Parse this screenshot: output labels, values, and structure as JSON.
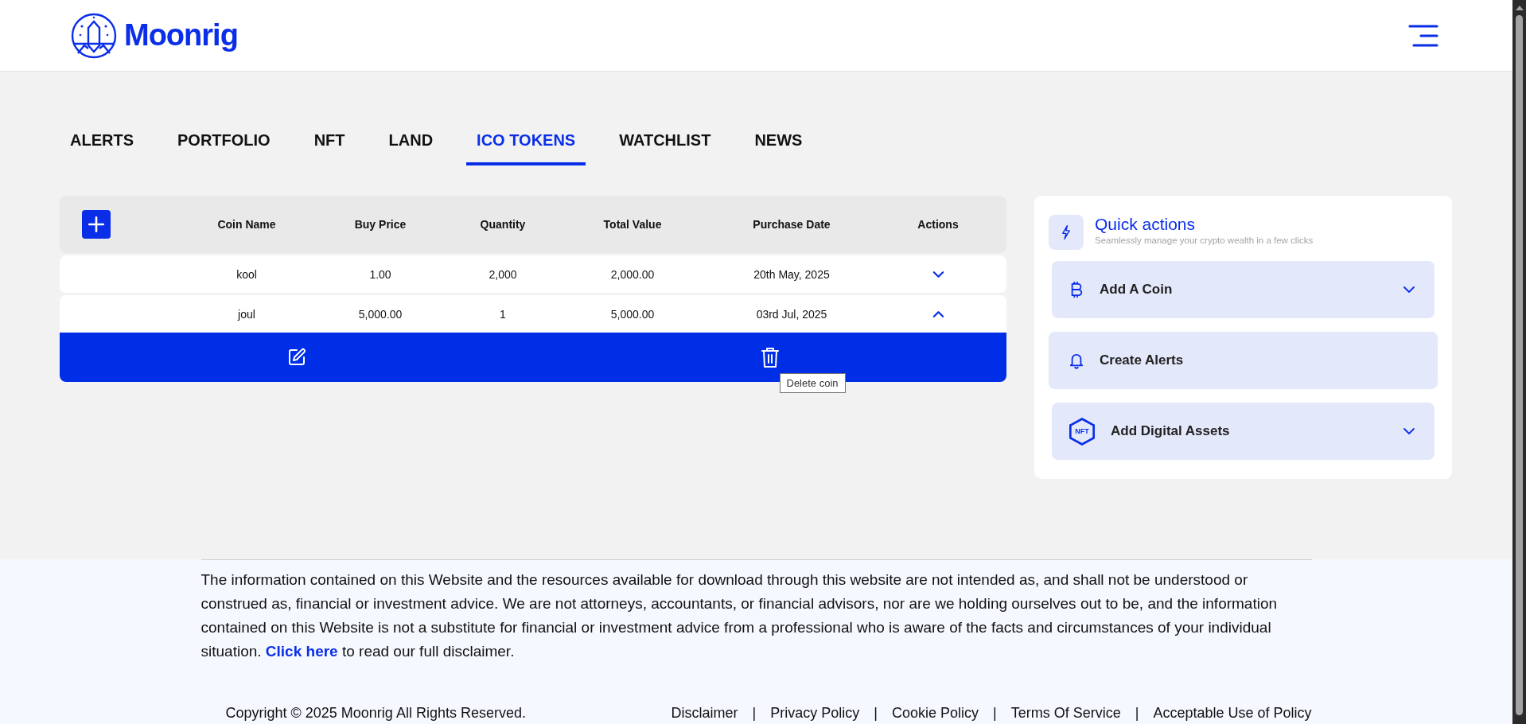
{
  "brand": {
    "name": "Moonrig"
  },
  "tabs": [
    {
      "label": "ALERTS",
      "selected": false
    },
    {
      "label": "PORTFOLIO",
      "selected": false
    },
    {
      "label": "NFT",
      "selected": false
    },
    {
      "label": "LAND",
      "selected": false
    },
    {
      "label": "ICO TOKENS",
      "selected": true
    },
    {
      "label": "WATCHLIST",
      "selected": false
    },
    {
      "label": "NEWS",
      "selected": false
    }
  ],
  "table": {
    "columns": [
      "Coin Name",
      "Buy Price",
      "Quantity",
      "Total Value",
      "Purchase Date",
      "Actions"
    ],
    "rows": [
      {
        "cells": [
          "kool",
          "1.00",
          "2,000",
          "2,000.00",
          "20th May, 2025"
        ],
        "expanded": false
      },
      {
        "cells": [
          "joul",
          "5,000.00",
          "1",
          "5,000.00",
          "03rd Jul, 2025"
        ],
        "expanded": true
      }
    ],
    "tooltip": "Delete coin"
  },
  "quick_actions": {
    "title": "Quick actions",
    "subtitle": "Seamlessly manage your crypto wealth in a few clicks",
    "items": [
      {
        "label": "Add A Coin",
        "kind": "coin"
      },
      {
        "label": "Create Alerts",
        "kind": "alert"
      },
      {
        "label": "Add Digital Assets",
        "kind": "asset",
        "icon_text": "NFT"
      }
    ]
  },
  "footer": {
    "disclaimer": "The information contained on this Website and the resources available for download through this website are not intended as, and shall not be understood or construed as, financial or investment advice. We are not attorneys, accountants, or financial advisors, nor are we holding ourselves out to be, and the information contained on this Website is not a substitute for financial or investment advice from a professional who is aware of the facts and circumstances of your individual situation.",
    "link": "Click here",
    "after_link": "to read our full disclaimer.",
    "copyright": "Copyright © 2025 Moonrig All Rights Reserved.",
    "links": [
      "Disclaimer",
      "Privacy Policy",
      "Cookie Policy",
      "Terms Of Service",
      "Acceptable Use of Policy"
    ],
    "separator": "|"
  }
}
